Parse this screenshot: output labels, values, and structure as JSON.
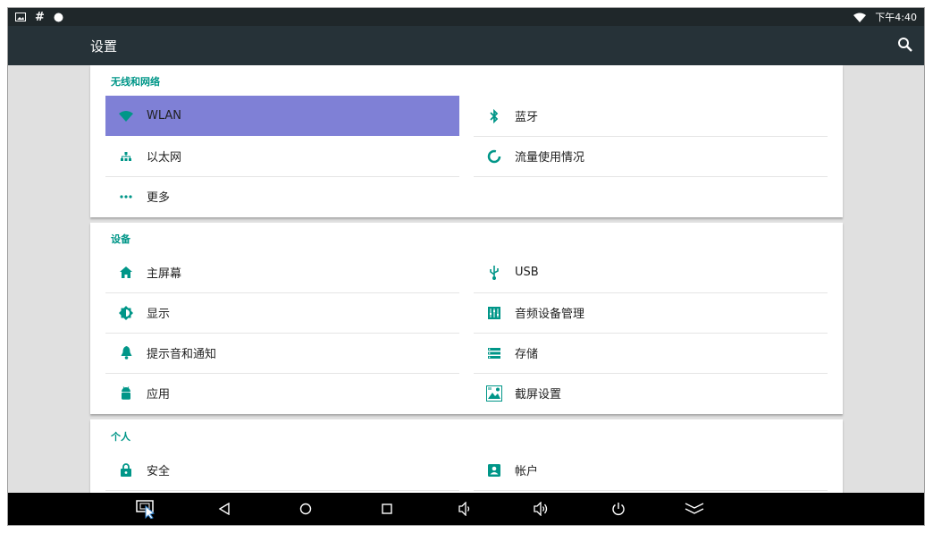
{
  "status_bar": {
    "time": "下午4:40",
    "icons": [
      "image-icon",
      "hash-icon",
      "circle-icon",
      "wifi-icon"
    ]
  },
  "app_bar": {
    "title": "设置",
    "search_icon": "search-icon"
  },
  "colors": {
    "accent": "#009688",
    "selected": "#7f80d6",
    "app_bar": "#263238",
    "status_bar": "#1f272a"
  },
  "sections": [
    {
      "header": "无线和网络",
      "items": [
        {
          "label": "WLAN",
          "icon": "wifi-icon",
          "selected": true
        },
        {
          "label": "蓝牙",
          "icon": "bluetooth-icon"
        },
        {
          "label": "以太网",
          "icon": "ethernet-icon"
        },
        {
          "label": "流量使用情况",
          "icon": "data-usage-icon"
        },
        {
          "label": "更多",
          "icon": "more-icon"
        }
      ]
    },
    {
      "header": "设备",
      "items": [
        {
          "label": "主屏幕",
          "icon": "home-icon"
        },
        {
          "label": "USB",
          "icon": "usb-icon"
        },
        {
          "label": "显示",
          "icon": "brightness-icon"
        },
        {
          "label": "音频设备管理",
          "icon": "equalizer-icon"
        },
        {
          "label": "提示音和通知",
          "icon": "bell-icon"
        },
        {
          "label": "存储",
          "icon": "storage-icon"
        },
        {
          "label": "应用",
          "icon": "android-icon"
        },
        {
          "label": "截屏设置",
          "icon": "screenshot-icon"
        }
      ]
    },
    {
      "header": "个人",
      "items": [
        {
          "label": "安全",
          "icon": "lock-icon"
        },
        {
          "label": "帐户",
          "icon": "account-icon"
        }
      ]
    }
  ],
  "nav_bar": {
    "buttons": [
      "screenshot-button-icon",
      "back-icon",
      "home-circle-icon",
      "recents-icon",
      "volume-down-icon",
      "volume-up-icon",
      "power-icon",
      "collapse-icon"
    ]
  }
}
